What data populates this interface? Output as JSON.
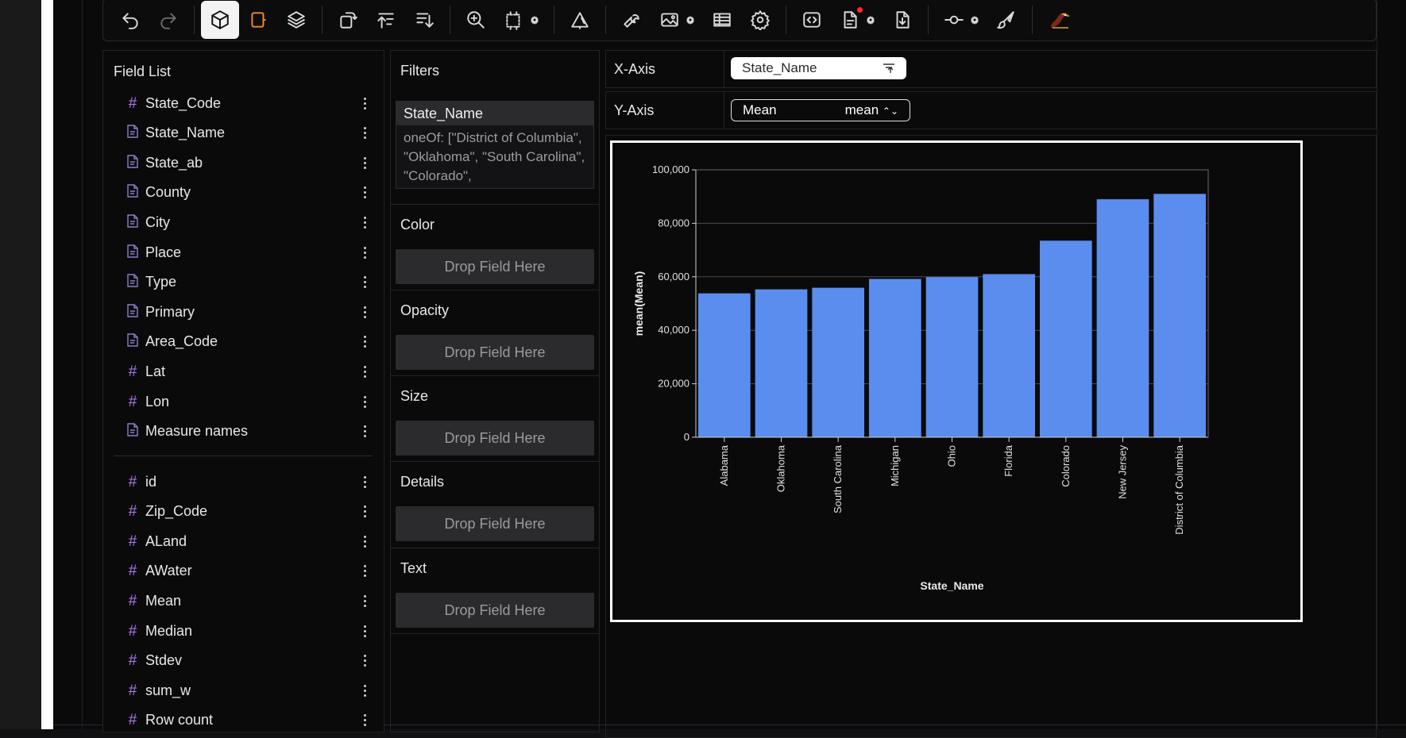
{
  "toolbar": {
    "buttons": [
      "undo-icon",
      "redo-icon",
      "cube-icon",
      "brush-select-icon",
      "layers-icon",
      "rotate-icon",
      "sort-ascending-icon",
      "sort-descending-icon",
      "zoom-in-icon",
      "resize-icon",
      "transparency-icon",
      "wrench-icon",
      "image-icon",
      "table-icon",
      "settings-icon",
      "code-icon",
      "document-icon",
      "download-icon",
      "commit-icon",
      "paintbrush-icon",
      "bird-logo-icon"
    ],
    "colors": {
      "active_bg": "#f3f3f3",
      "accent_orange": "#f08a2a",
      "notification_dot": "#ff2a2a"
    }
  },
  "field_list": {
    "title": "Field List",
    "dimensions": [
      {
        "type": "number",
        "label": "State_Code"
      },
      {
        "type": "text",
        "label": "State_Name"
      },
      {
        "type": "text",
        "label": "State_ab"
      },
      {
        "type": "text",
        "label": "County"
      },
      {
        "type": "text",
        "label": "City"
      },
      {
        "type": "text",
        "label": "Place"
      },
      {
        "type": "text",
        "label": "Type"
      },
      {
        "type": "text",
        "label": "Primary"
      },
      {
        "type": "text",
        "label": "Area_Code"
      },
      {
        "type": "number",
        "label": "Lat"
      },
      {
        "type": "number",
        "label": "Lon"
      },
      {
        "type": "text",
        "label": "Measure names"
      }
    ],
    "measures": [
      {
        "type": "number",
        "label": "id"
      },
      {
        "type": "number",
        "label": "Zip_Code"
      },
      {
        "type": "number",
        "label": "ALand"
      },
      {
        "type": "number",
        "label": "AWater"
      },
      {
        "type": "number",
        "label": "Mean"
      },
      {
        "type": "number",
        "label": "Median"
      },
      {
        "type": "number",
        "label": "Stdev"
      },
      {
        "type": "number",
        "label": "sum_w"
      },
      {
        "type": "number",
        "label": "Row count"
      }
    ]
  },
  "filters": {
    "title": "Filters",
    "card_field": "State_Name",
    "card_rule": "oneOf: [\"District of Columbia\", \"Oklahoma\", \"South Carolina\", \"Colorado\","
  },
  "channels": [
    {
      "label": "Color",
      "drop": "Drop Field Here"
    },
    {
      "label": "Opacity",
      "drop": "Drop Field Here"
    },
    {
      "label": "Size",
      "drop": "Drop Field Here"
    },
    {
      "label": "Details",
      "drop": "Drop Field Here"
    },
    {
      "label": "Text",
      "drop": "Drop Field Here"
    }
  ],
  "x_axis": {
    "label": "X-Axis",
    "field": "State_Name"
  },
  "y_axis": {
    "label": "Y-Axis",
    "field": "Mean",
    "agg": "mean"
  },
  "chart_data": {
    "type": "bar",
    "categories": [
      "Alabama",
      "Oklahoma",
      "South Carolina",
      "Michigan",
      "Ohio",
      "Florida",
      "Colorado",
      "New Jersey",
      "District of Columbia"
    ],
    "values": [
      53800,
      55300,
      55900,
      59200,
      59900,
      61000,
      73500,
      89000,
      91000
    ],
    "xlabel": "State_Name",
    "ylabel": "mean(Mean)",
    "ylim": [
      0,
      100000
    ],
    "yticks": [
      "0",
      "20,000",
      "40,000",
      "60,000",
      "80,000",
      "100,000"
    ],
    "grid": true,
    "bar_color": "#5b8def"
  }
}
